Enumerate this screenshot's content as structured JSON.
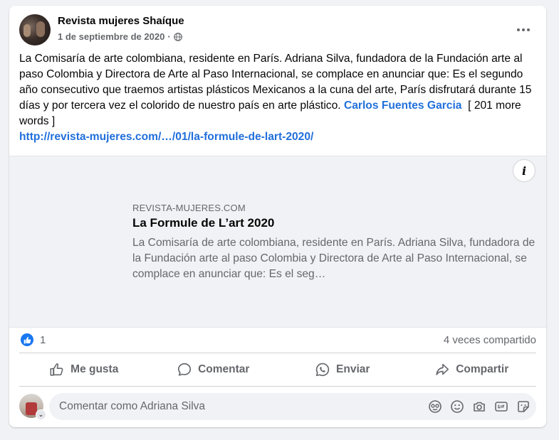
{
  "post": {
    "page_name": "Revista mujeres Shaíque",
    "date": "1 de septiembre de 2020",
    "separator": "·",
    "body_text": "La Comisaría de arte colombiana, residente en París. Adriana Silva, fundadora de la Fundación arte al paso Colombia y Directora de Arte al Paso Internacional, se complace en anunciar que: Es el segundo año consecutivo que traemos artistas plásticos Mexicanos a la cuna del arte, París disfrutará durante 15 días y por tercera vez el colorido de nuestro país en arte plástico.",
    "mention": "Carlos Fuentes Garcia",
    "more_words": "[ 201 more words ]",
    "url": "http://revista-mujeres.com/…/01/la-formule-de-lart-2020/"
  },
  "link_preview": {
    "domain": "REVISTA-MUJERES.COM",
    "title": "La Formule de L’art 2020",
    "description": "La Comisaría de arte colombiana, residente en París. Adriana Silva, fundadora de la Fundación arte al paso Colombia y Directora de Arte al Paso Internacional, se complace en anunciar que: Es el seg…",
    "info_glyph": "i"
  },
  "stats": {
    "like_count": "1",
    "shares": "4 veces compartido"
  },
  "actions": {
    "like": "Me gusta",
    "comment": "Comentar",
    "send": "Enviar",
    "share": "Compartir"
  },
  "comment_box": {
    "placeholder": "Comentar como Adriana Silva",
    "badge_glyph": "⌄",
    "icons": [
      "avatar-sticker-icon",
      "emoji-icon",
      "camera-icon",
      "gif-icon",
      "sticker-icon"
    ]
  },
  "colors": {
    "link_blue": "#216fdb",
    "like_blue": "#1877f2",
    "secondary_text": "#65676b"
  }
}
